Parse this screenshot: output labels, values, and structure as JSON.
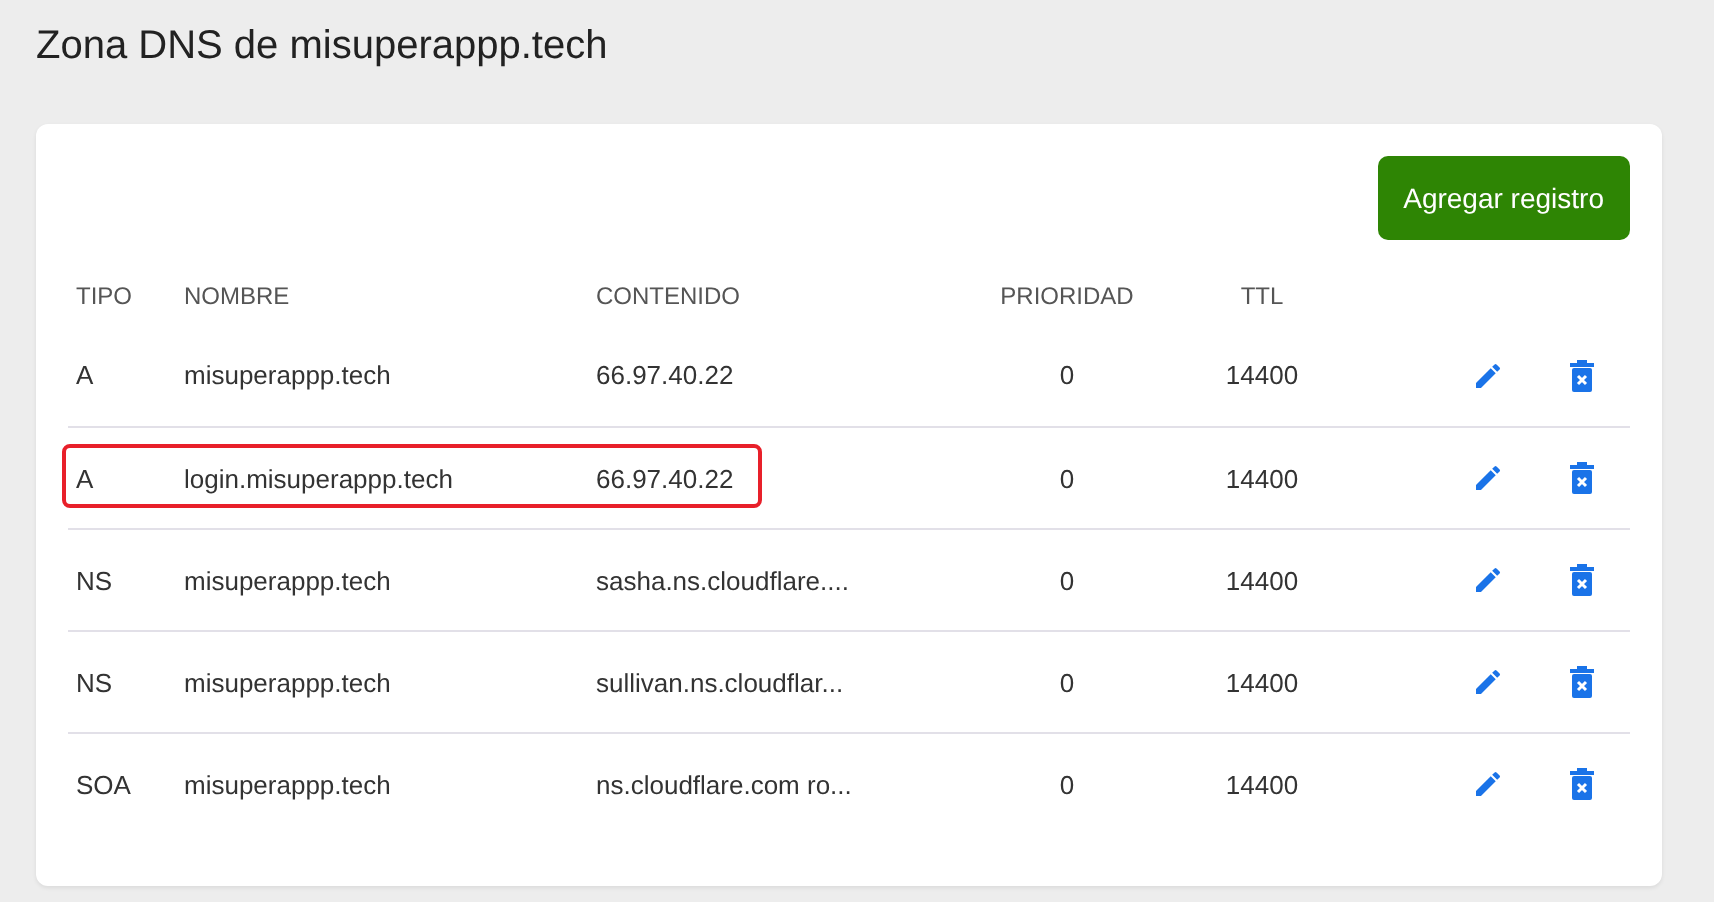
{
  "title": "Zona DNS de misuperappp.tech",
  "add_button": "Agregar registro",
  "table": {
    "columns": [
      "TIPO",
      "NOMBRE",
      "CONTENIDO",
      "PRIORIDAD",
      "TTL"
    ],
    "rows": [
      {
        "tipo": "A",
        "nombre": "misuperappp.tech",
        "contenido": "66.97.40.22",
        "prioridad": "0",
        "ttl": "14400",
        "highlighted": false
      },
      {
        "tipo": "A",
        "nombre": "login.misuperappp.tech",
        "contenido": "66.97.40.22",
        "prioridad": "0",
        "ttl": "14400",
        "highlighted": true
      },
      {
        "tipo": "NS",
        "nombre": "misuperappp.tech",
        "contenido": "sasha.ns.cloudflare....",
        "prioridad": "0",
        "ttl": "14400",
        "highlighted": false
      },
      {
        "tipo": "NS",
        "nombre": "misuperappp.tech",
        "contenido": "sullivan.ns.cloudflar...",
        "prioridad": "0",
        "ttl": "14400",
        "highlighted": false
      },
      {
        "tipo": "SOA",
        "nombre": "misuperappp.tech",
        "contenido": "ns.cloudflare.com ro...",
        "prioridad": "0",
        "ttl": "14400",
        "highlighted": false
      }
    ]
  }
}
